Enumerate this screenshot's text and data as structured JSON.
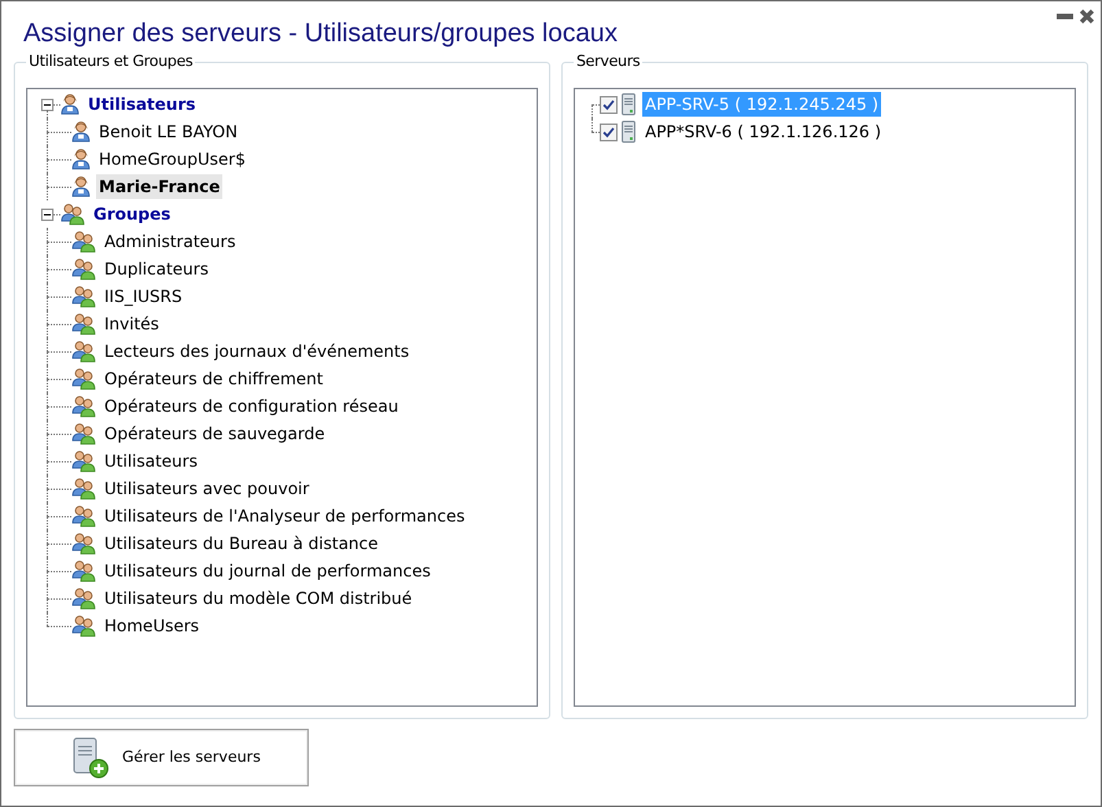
{
  "window": {
    "title": "Assigner des serveurs - Utilisateurs/groupes locaux"
  },
  "users_groups": {
    "label": "Utilisateurs et Groupes",
    "tree": [
      {
        "label": "Utilisateurs",
        "kind": "user",
        "expanded": true,
        "selected": false,
        "children": [
          {
            "label": "Benoit LE BAYON",
            "kind": "user",
            "selected": false
          },
          {
            "label": "HomeGroupUser$",
            "kind": "user",
            "selected": false
          },
          {
            "label": "Marie-France",
            "kind": "user",
            "selected": true
          }
        ]
      },
      {
        "label": "Groupes",
        "kind": "group",
        "expanded": true,
        "selected": false,
        "children": [
          {
            "label": "Administrateurs",
            "kind": "group",
            "selected": false
          },
          {
            "label": "Duplicateurs",
            "kind": "group",
            "selected": false
          },
          {
            "label": "IIS_IUSRS",
            "kind": "group",
            "selected": false
          },
          {
            "label": "Invités",
            "kind": "group",
            "selected": false
          },
          {
            "label": "Lecteurs des journaux d'événements",
            "kind": "group",
            "selected": false
          },
          {
            "label": "Opérateurs de chiffrement",
            "kind": "group",
            "selected": false
          },
          {
            "label": "Opérateurs de configuration réseau",
            "kind": "group",
            "selected": false
          },
          {
            "label": "Opérateurs de sauvegarde",
            "kind": "group",
            "selected": false
          },
          {
            "label": "Utilisateurs",
            "kind": "group",
            "selected": false
          },
          {
            "label": "Utilisateurs avec pouvoir",
            "kind": "group",
            "selected": false
          },
          {
            "label": "Utilisateurs de l'Analyseur de performances",
            "kind": "group",
            "selected": false
          },
          {
            "label": "Utilisateurs du Bureau à distance",
            "kind": "group",
            "selected": false
          },
          {
            "label": "Utilisateurs du journal de performances",
            "kind": "group",
            "selected": false
          },
          {
            "label": "Utilisateurs du modèle COM distribué",
            "kind": "group",
            "selected": false
          },
          {
            "label": "HomeUsers",
            "kind": "group",
            "selected": false
          }
        ]
      }
    ]
  },
  "servers": {
    "label": "Serveurs",
    "items": [
      {
        "label": "APP-SRV-5 ( 192.1.245.245 )",
        "checked": true,
        "selected": true
      },
      {
        "label": "APP*SRV-6 ( 192.1.126.126 )",
        "checked": true,
        "selected": false
      }
    ]
  },
  "manage_button": {
    "label": "Gérer les serveurs"
  }
}
